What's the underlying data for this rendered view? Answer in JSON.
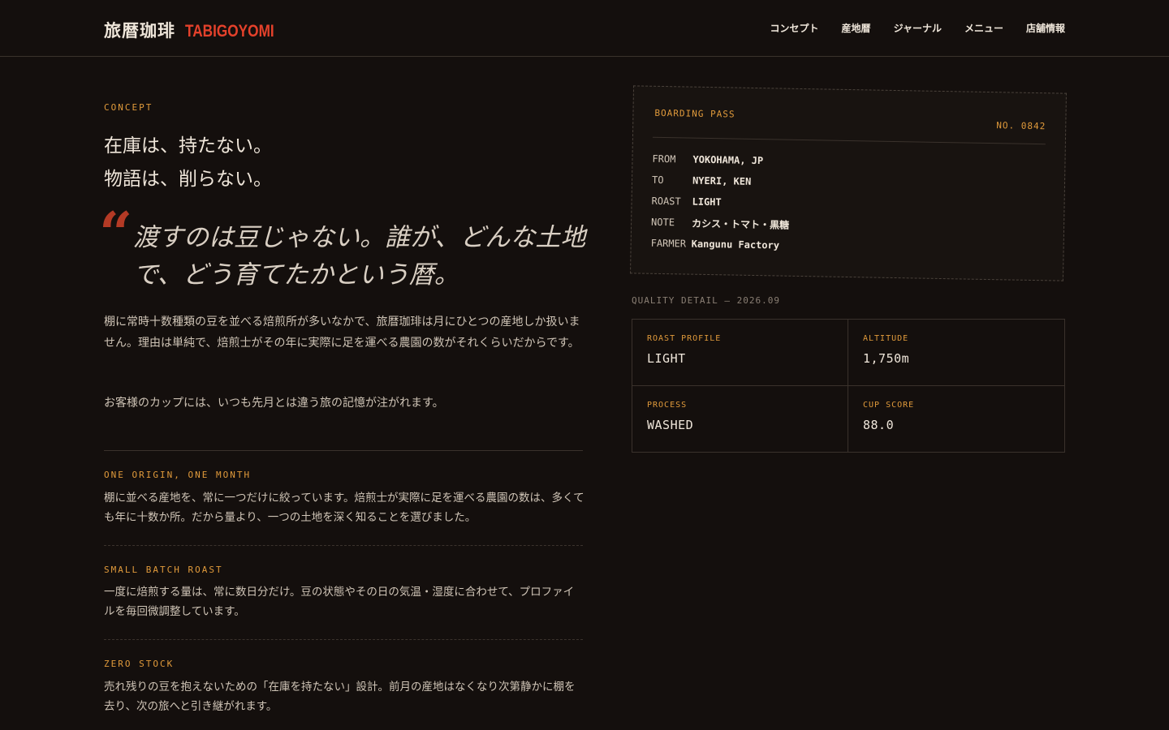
{
  "header": {
    "brand_jp": "旅暦珈琲",
    "brand_en": "TABIGOYOMI",
    "nav": [
      "コンセプト",
      "産地暦",
      "ジャーナル",
      "メニュー",
      "店舗情報"
    ]
  },
  "concept": {
    "label": "CONCEPT",
    "headline_1": "在庫は、持たない。",
    "headline_2": "物語は、削らない。",
    "quote_mark": "“",
    "quote": "渡すのは豆じゃない。誰が、どんな土地で、どう育てたかという暦。",
    "para_1": "棚に常時十数種類の豆を並べる焙煎所が多いなかで、旅暦珈琲は月にひとつの産地しか扱いません。理由は単純で、焙煎士がその年に実際に足を運べる農園の数がそれくらいだからです。",
    "para_2": "お客様のカップには、いつも先月とは違う旅の記憶が注がれます。"
  },
  "features": [
    {
      "title": "ONE ORIGIN, ONE MONTH",
      "body": "棚に並べる産地を、常に一つだけに絞っています。焙煎士が実際に足を運べる農園の数は、多くても年に十数か所。だから量より、一つの土地を深く知ることを選びました。"
    },
    {
      "title": "SMALL BATCH ROAST",
      "body": "一度に焙煎する量は、常に数日分だけ。豆の状態やその日の気温・湿度に合わせて、プロファイルを毎回微調整しています。"
    },
    {
      "title": "ZERO STOCK",
      "body": "売れ残りの豆を抱えないための「在庫を持たない」設計。前月の産地はなくなり次第静かに棚を去り、次の旅へと引き継がれます。"
    }
  ],
  "boarding_pass": {
    "label": "BOARDING PASS",
    "number": "NO. 0842",
    "rows": [
      {
        "key": "FROM",
        "value": "YOKOHAMA, JP"
      },
      {
        "key": "TO",
        "value": "NYERI, KEN"
      },
      {
        "key": "ROAST",
        "value": "LIGHT"
      },
      {
        "key": "NOTE",
        "value": "カシス・トマト・黒糖"
      },
      {
        "key": "FARMER",
        "value": "Kangunu Factory"
      }
    ]
  },
  "quality": {
    "label": "QUALITY DETAIL — 2026.09",
    "cells": [
      {
        "label": "ROAST PROFILE",
        "value": "LIGHT"
      },
      {
        "label": "ALTITUDE",
        "value": "1,750m"
      },
      {
        "label": "PROCESS",
        "value": "WASHED"
      },
      {
        "label": "CUP SCORE",
        "value": "88.0"
      }
    ]
  },
  "colors": {
    "background": "#140f0d",
    "accent_orange": "#e09a3b",
    "brand_red": "#e4412b",
    "quote_red": "#b43a25"
  }
}
